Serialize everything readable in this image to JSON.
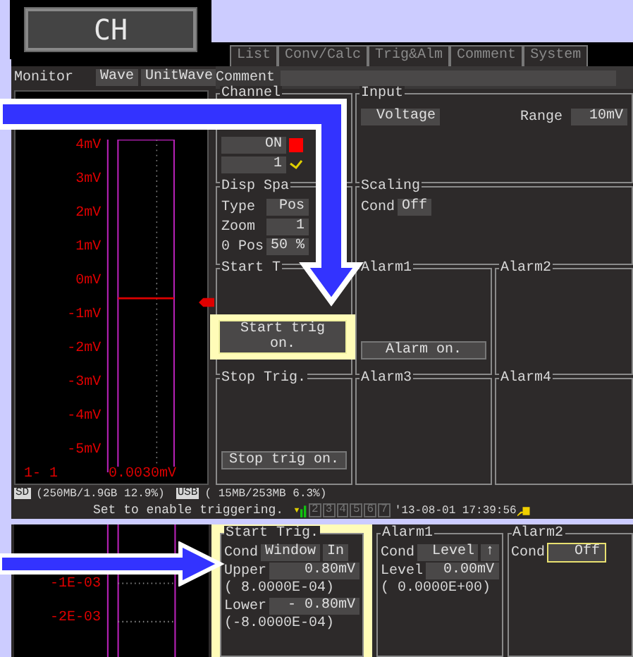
{
  "header_button": "CH",
  "tabs": [
    {
      "label": "List",
      "selected": false
    },
    {
      "label": "Conv/Calc",
      "selected": false
    },
    {
      "label": "Trig&Alm",
      "selected": false
    },
    {
      "label": "Comment",
      "selected": false
    },
    {
      "label": "System",
      "selected": false
    }
  ],
  "monitor": {
    "label": "Monitor",
    "buttons": [
      "Wave",
      "UnitWave"
    ]
  },
  "chart": {
    "axis_labels": [
      "4mV",
      "3mV",
      "2mV",
      "1mV",
      "0mV",
      "-1mV",
      "-2mV",
      "-3mV",
      "-4mV",
      "-5mV"
    ],
    "channel": "1- 1",
    "reading": "0.0030mV"
  },
  "comment_label": "Comment",
  "channel": {
    "title": "Channel",
    "state": "ON",
    "number": "1"
  },
  "input": {
    "title": "Input",
    "type": "Voltage",
    "range_label": "Range",
    "range": "10mV"
  },
  "disp_span": {
    "title": "Disp Spa",
    "rows": [
      {
        "label": "Type",
        "value": "Pos"
      },
      {
        "label": "Zoom",
        "value": "1"
      },
      {
        "label": "0 Pos",
        "value": "50 %"
      }
    ]
  },
  "scaling": {
    "title": "Scaling",
    "cond_label": "Cond",
    "cond": "Off"
  },
  "start_trig": {
    "title": "Start T",
    "button": "Start trig on."
  },
  "stop_trig": {
    "title": "Stop Trig.",
    "button": "Stop trig on."
  },
  "alarms": [
    {
      "title": "Alarm1",
      "button": "Alarm on."
    },
    {
      "title": "Alarm2"
    },
    {
      "title": "Alarm3"
    },
    {
      "title": "Alarm4"
    }
  ],
  "storage": [
    {
      "device": "SD",
      "usage": "(250MB/1.9GB 12.9%)"
    },
    {
      "device": "USB",
      "usage": "( 15MB/253MB  6.3%)"
    }
  ],
  "status_message": "Set to enable triggering.",
  "slots": [
    "2",
    "3",
    "4",
    "5",
    "6",
    "7"
  ],
  "datetime": "'13-08-01 17:39:56",
  "detail": {
    "axis_labels": [
      "-1E-03",
      "-2E-03"
    ],
    "start_trig": {
      "title": "Start Trig.",
      "cond_label": "Cond",
      "cond": "Window",
      "cond_side": "In",
      "upper_label": "Upper",
      "upper": "0.80mV",
      "upper_exp": "( 8.0000E-04)",
      "lower_label": "Lower",
      "lower": "- 0.80mV",
      "lower_exp": "(-8.0000E-04)"
    },
    "alarm1": {
      "title": "Alarm1",
      "cond_label": "Cond",
      "cond": "Level",
      "direction": "↑",
      "level_label": "Level",
      "level": "0.00mV",
      "level_exp": "( 0.0000E+00)"
    },
    "alarm2": {
      "title": "Alarm2",
      "cond_label": "Cond",
      "cond": "Off",
      "focused": true
    }
  }
}
